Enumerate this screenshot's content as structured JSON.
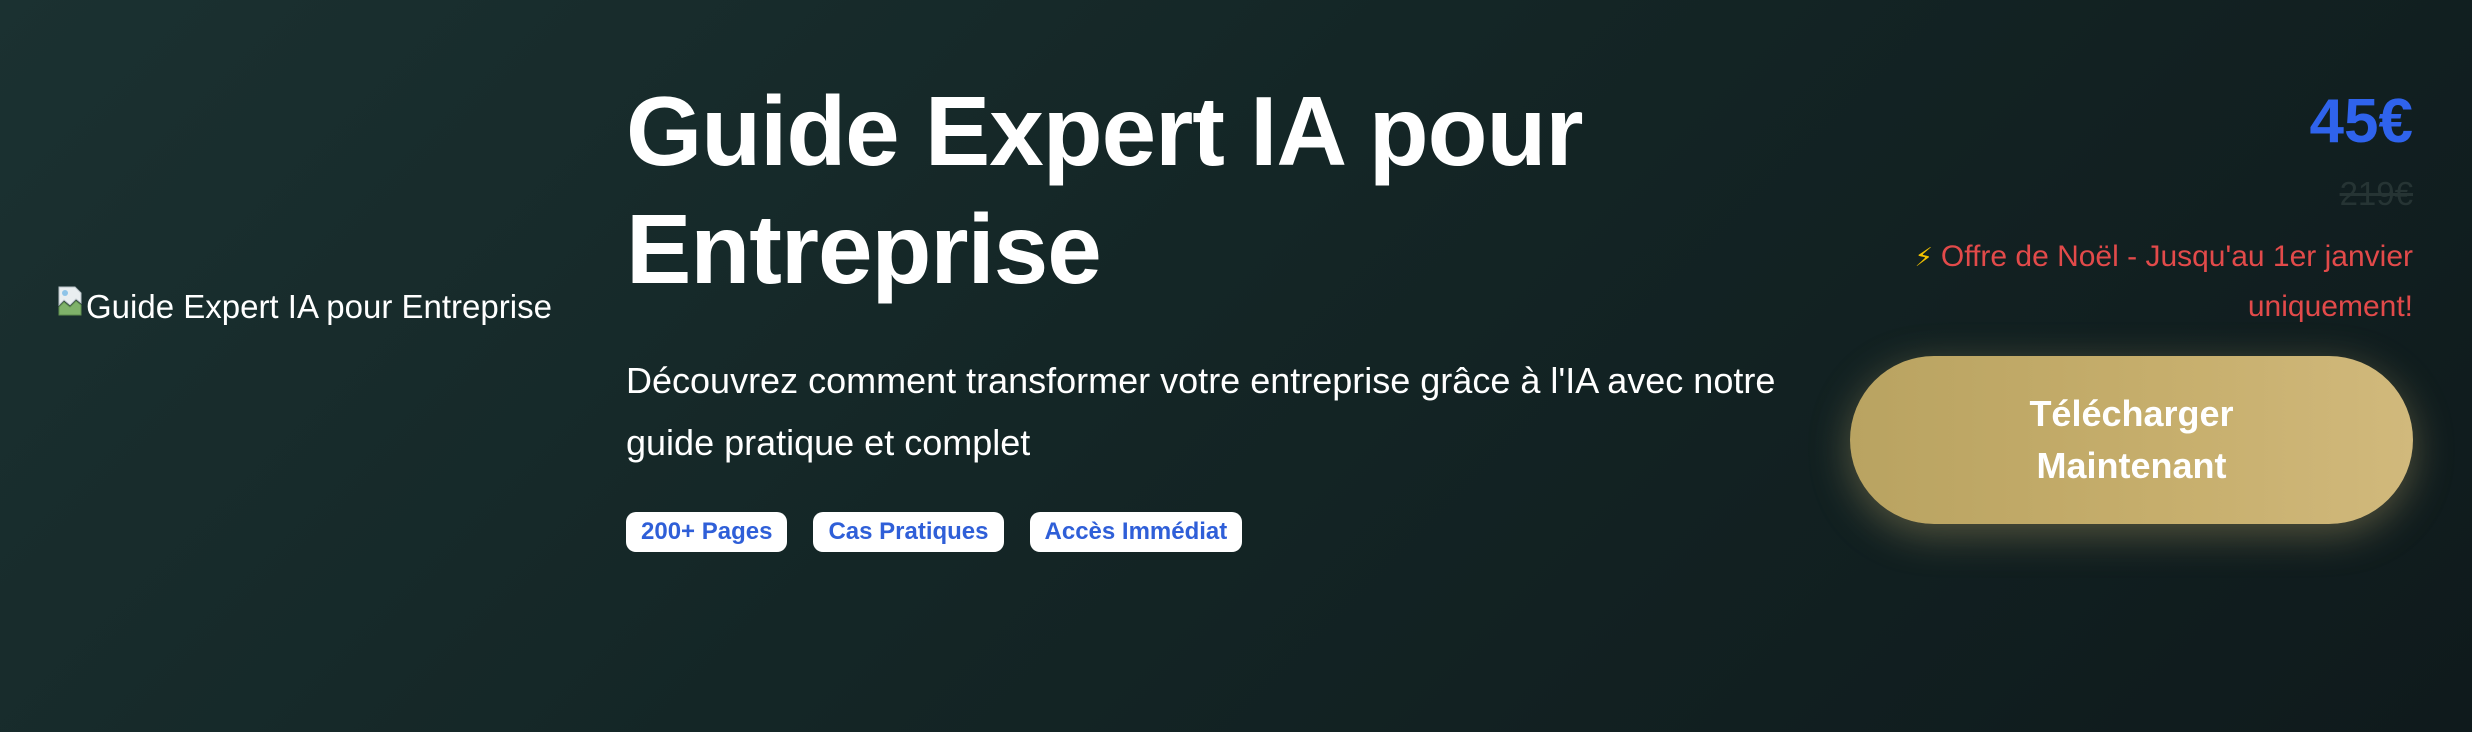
{
  "product": {
    "image_alt": "Guide Expert IA pour Entreprise",
    "title": "Guide Expert IA pour Entreprise",
    "subtitle": "Découvrez comment transformer votre entreprise grâce à l'IA avec notre guide pratique et complet",
    "badges": [
      "200+ Pages",
      "Cas Pratiques",
      "Accès Immédiat"
    ]
  },
  "pricing": {
    "price": "45€",
    "old_price": "219€",
    "offer_icon": "⚡",
    "offer_text": "Offre de Noël - Jusqu'au 1er janvier uniquement!",
    "cta_label": "Télécharger Maintenant"
  },
  "colors": {
    "background": "#142626",
    "price": "#2f63ec",
    "offer": "#e24a4a",
    "cta": "#c6ae6c",
    "badge_text": "#2f5fd8"
  },
  "icons": {
    "broken_image": "broken-image-icon",
    "offer": "lightning-icon"
  }
}
